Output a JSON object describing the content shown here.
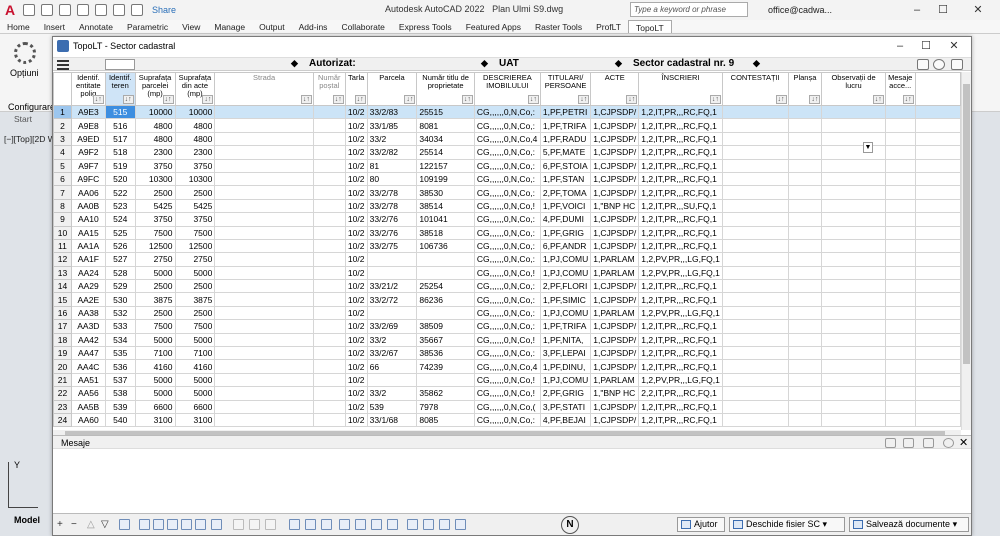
{
  "acad": {
    "app_title": "Autodesk AutoCAD 2022",
    "doc_title": "Plan Ulmi S9.dwg",
    "share": "Share",
    "search_placeholder": "Type a keyword or phrase",
    "user": "office@cadwa...",
    "ribbon_tabs": [
      "Home",
      "Insert",
      "Annotate",
      "Parametric",
      "View",
      "Manage",
      "Output",
      "Add-ins",
      "Collaborate",
      "Express Tools",
      "Featured Apps",
      "Raster Tools",
      "ProfLT",
      "TopoLT"
    ],
    "active_tab": "TopoLT",
    "options_label": "Opțiuni",
    "configure_label": "Configurare",
    "start_tab": "Start",
    "viewport_label": "[−][Top][2D W",
    "model_tab": "Model",
    "ucs_y": "Y"
  },
  "window": {
    "title": "TopoLT - Sector cadastral",
    "band": {
      "autorizat_label": "Autorizat:",
      "uat_label": "UAT",
      "sector_label": "Sector cadastral nr. 9",
      "diamond": "◆"
    },
    "columns": [
      "Identif. entitate polig",
      "Identif. teren",
      "Suprafața parcelei (mp)",
      "Suprafața din acte (mp)",
      "Strada",
      "Număr poștal",
      "Tarla",
      "Parcela",
      "Număr titlu de proprietate",
      "DESCRIEREA IMOBILULUI",
      "TITULARI/ PERSOANE",
      "ACTE",
      "ÎNSCRIERI",
      "CONTESTAȚII",
      "Planșa",
      "Observații de lucru",
      "Mesaje acce..."
    ],
    "sort_glyph": "↓↑",
    "rows": [
      [
        "1",
        "A9E3",
        "515",
        "10000",
        "10000",
        "",
        "",
        "10/2",
        "33/2/83",
        "25515",
        "CG,,,,,,0,N,Co,:",
        "1,PF,PETRI",
        "1,CJPSDP/",
        "1,2,IT,PR,,,RC,FQ,1"
      ],
      [
        "2",
        "A9E8",
        "516",
        "4800",
        "4800",
        "",
        "",
        "10/2",
        "33/1/85",
        "8081",
        "CG,,,,,,0,N,Co,:",
        "1,PF,TRIFA",
        "1,CJPSDP/",
        "1,2,IT,PR,,,RC,FQ,1"
      ],
      [
        "3",
        "A9ED",
        "517",
        "4800",
        "4800",
        "",
        "",
        "10/2",
        "33/2",
        "34034",
        "CG,,,,,,0,N,Co,4",
        "1,PF,RADU",
        "1,CJPSDP/",
        "1,2,IT,PR,,,RC,FQ,1"
      ],
      [
        "4",
        "A9F2",
        "518",
        "2300",
        "2300",
        "",
        "",
        "10/2",
        "33/2/82",
        "25514",
        "CG,,,,,,0,N,Co,:",
        "5,PF,MATE",
        "1,CJPSDP/",
        "1,2,IT,PR,,,RC,FQ,1"
      ],
      [
        "5",
        "A9F7",
        "519",
        "3750",
        "3750",
        "",
        "",
        "10/2",
        "81",
        "122157",
        "CG,,,,,,0,N,Co,:",
        "6,PF,STOIA",
        "1,CJPSDP/",
        "1,2,IT,PR,,,RC,FQ,1"
      ],
      [
        "6",
        "A9FC",
        "520",
        "10300",
        "10300",
        "",
        "",
        "10/2",
        "80",
        "109199",
        "CG,,,,,,0,N,Co,:",
        "1,PF,STAN",
        "1,CJPSDP/",
        "1,2,IT,PR,,,RC,FQ,1"
      ],
      [
        "7",
        "AA06",
        "522",
        "2500",
        "2500",
        "",
        "",
        "10/2",
        "33/2/78",
        "38530",
        "CG,,,,,,0,N,Co,:",
        "2,PF,TOMA",
        "1,CJPSDP/",
        "1,2,IT,PR,,,RC,FQ,1"
      ],
      [
        "8",
        "AA0B",
        "523",
        "5425",
        "5425",
        "",
        "",
        "10/2",
        "33/2/78",
        "38514",
        "CG,,,,,,0,N,Co,!",
        "1,PF,VOICI",
        "1,\"BNP HC",
        "1,2,IT,PR,,,SU,FQ,1"
      ],
      [
        "9",
        "AA10",
        "524",
        "3750",
        "3750",
        "",
        "",
        "10/2",
        "33/2/76",
        "101041",
        "CG,,,,,,0,N,Co,:",
        "4,PF,DUMI",
        "1,CJPSDP/",
        "1,2,IT,PR,,,RC,FQ,1"
      ],
      [
        "10",
        "AA15",
        "525",
        "7500",
        "7500",
        "",
        "",
        "10/2",
        "33/2/76",
        "38518",
        "CG,,,,,,0,N,Co,:",
        "1,PF,GRIG",
        "1,CJPSDP/",
        "1,2,IT,PR,,,RC,FQ,1"
      ],
      [
        "11",
        "AA1A",
        "526",
        "12500",
        "12500",
        "",
        "",
        "10/2",
        "33/2/75",
        "106736",
        "CG,,,,,,0,N,Co,:",
        "6,PF,ANDR",
        "1,CJPSDP/",
        "1,2,IT,PR,,,RC,FQ,1"
      ],
      [
        "12",
        "AA1F",
        "527",
        "2750",
        "2750",
        "",
        "",
        "10/2",
        "",
        "",
        "CG,,,,,,0,N,Co,:",
        "1,PJ,COMU",
        "1,PARLAM",
        "1,2,PV,PR,,,LG,FQ,1"
      ],
      [
        "13",
        "AA24",
        "528",
        "5000",
        "5000",
        "",
        "",
        "10/2",
        "",
        "",
        "CG,,,,,,0,N,Co,!",
        "1,PJ,COMU",
        "1,PARLAM",
        "1,2,PV,PR,,,LG,FQ,1"
      ],
      [
        "14",
        "AA29",
        "529",
        "2500",
        "2500",
        "",
        "",
        "10/2",
        "33/21/2",
        "25254",
        "CG,,,,,,0,N,Co,:",
        "2,PF,FLORI",
        "1,CJPSDP/",
        "1,2,IT,PR,,,RC,FQ,1"
      ],
      [
        "15",
        "AA2E",
        "530",
        "3875",
        "3875",
        "",
        "",
        "10/2",
        "33/2/72",
        "86236",
        "CG,,,,,,0,N,Co,:",
        "1,PF,SIMIC",
        "1,CJPSDP/",
        "1,2,IT,PR,,,RC,FQ,1"
      ],
      [
        "16",
        "AA38",
        "532",
        "2500",
        "2500",
        "",
        "",
        "10/2",
        "",
        "",
        "CG,,,,,,0,N,Co,:",
        "1,PJ,COMU",
        "1,PARLAM",
        "1,2,PV,PR,,,LG,FQ,1"
      ],
      [
        "17",
        "AA3D",
        "533",
        "7500",
        "7500",
        "",
        "",
        "10/2",
        "33/2/69",
        "38509",
        "CG,,,,,,0,N,Co,:",
        "1,PF,TRIFA",
        "1,CJPSDP/",
        "1,2,IT,PR,,,RC,FQ,1"
      ],
      [
        "18",
        "AA42",
        "534",
        "5000",
        "5000",
        "",
        "",
        "10/2",
        "33/2",
        "35667",
        "CG,,,,,,0,N,Co,!",
        "1,PF,NITA,",
        "1,CJPSDP/",
        "1,2,IT,PR,,,RC,FQ,1"
      ],
      [
        "19",
        "AA47",
        "535",
        "7100",
        "7100",
        "",
        "",
        "10/2",
        "33/2/67",
        "38536",
        "CG,,,,,,0,N,Co,:",
        "3,PF,LEPAI",
        "1,CJPSDP/",
        "1,2,IT,PR,,,RC,FQ,1"
      ],
      [
        "20",
        "AA4C",
        "536",
        "4160",
        "4160",
        "",
        "",
        "10/2",
        "66",
        "74239",
        "CG,,,,,,0,N,Co,4",
        "1,PF,DINU,",
        "1,CJPSDP/",
        "1,2,IT,PR,,,RC,FQ,1"
      ],
      [
        "21",
        "AA51",
        "537",
        "5000",
        "5000",
        "",
        "",
        "10/2",
        "",
        "",
        "CG,,,,,,0,N,Co,!",
        "1,PJ,COMU",
        "1,PARLAM",
        "1,2,PV,PR,,,LG,FQ,1"
      ],
      [
        "22",
        "AA56",
        "538",
        "5000",
        "5000",
        "",
        "",
        "10/2",
        "33/2",
        "35862",
        "CG,,,,,,0,N,Co,!",
        "2,PF,GRIG",
        "1,\"BNP HC",
        "2,2,IT,PR,,,RC,FQ,1"
      ],
      [
        "23",
        "AA5B",
        "539",
        "6600",
        "6600",
        "",
        "",
        "10/2",
        "539",
        "7978",
        "CG,,,,,,0,N,Co,(",
        "3,PF,STATI",
        "1,CJPSDP/",
        "1,2,IT,PR,,,RC,FQ,1"
      ],
      [
        "24",
        "AA60",
        "540",
        "3100",
        "3100",
        "",
        "",
        "10/2",
        "33/1/68",
        "8085",
        "CG,,,,,,0,N,Co,:",
        "4,PF,BEJAI",
        "1,CJPSDP/",
        "1,2,IT,PR,,,RC,FQ,1"
      ]
    ],
    "selected_row": 0,
    "messages_title": "Mesaje",
    "buttons": {
      "help": "Ajutor",
      "open_sc": "Deschide fisier SC",
      "save_docs": "Salvează documente"
    },
    "nav": {
      "add": "+",
      "remove": "−",
      "up": "△",
      "down": "▽"
    },
    "compass": "N"
  }
}
